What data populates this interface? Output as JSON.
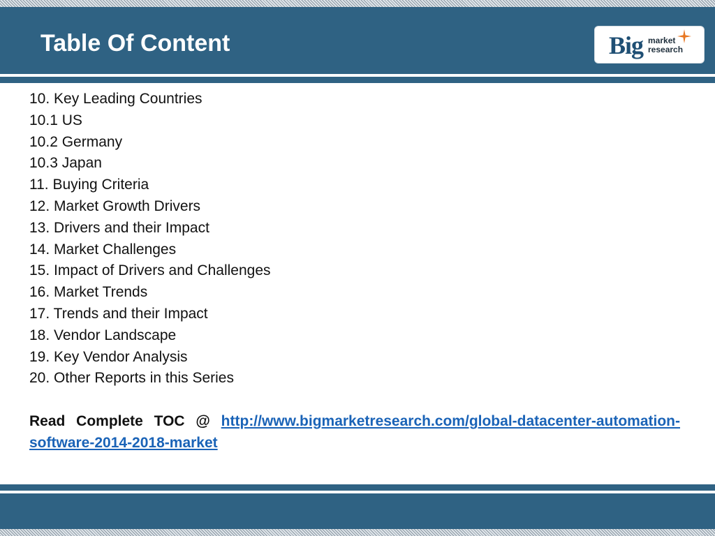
{
  "header": {
    "title": "Table Of Content",
    "logo": {
      "big": "Big",
      "line1": "market",
      "line2": "research",
      "spark_color": "#e87722",
      "brand_color": "#1f4f74"
    }
  },
  "toc": {
    "items": [
      "10. Key Leading Countries",
      "10.1 US",
      "10.2 Germany",
      "10.3 Japan",
      "11. Buying Criteria",
      "12. Market Growth Drivers",
      "13. Drivers and their Impact",
      "14. Market Challenges",
      "15. Impact of Drivers and Challenges",
      "16. Market Trends",
      "17. Trends and their Impact",
      "18. Vendor Landscape",
      "19. Key Vendor Analysis",
      "20. Other Reports in this Series"
    ]
  },
  "footer_note": {
    "prefix": "Read Complete TOC @ ",
    "link_text": "http://www.bigmarketresearch.com/global-datacenter-automation-software-2014-2018-market"
  },
  "colors": {
    "band": "#2f6283",
    "link": "#1a63b7"
  }
}
